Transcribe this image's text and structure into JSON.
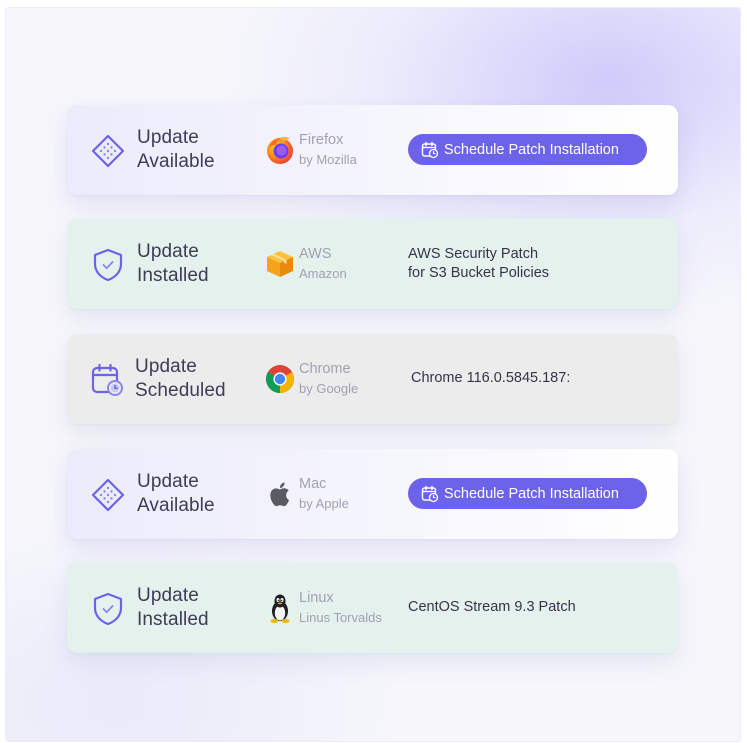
{
  "cards": [
    {
      "status_line1": "Update",
      "status_line2": "Available",
      "status_icon": "diamond-icon",
      "brand": "Firefox",
      "brand_sub": "by Mozilla",
      "brand_icon": "firefox-logo",
      "action_label": "Schedule Patch Installation"
    },
    {
      "status_line1": "Update",
      "status_line2": "Installed",
      "status_icon": "shield-check-icon",
      "brand": "AWS",
      "brand_sub": "Amazon",
      "brand_icon": "aws-box-logo",
      "info_line1": "AWS Security Patch",
      "info_line2": "for S3 Bucket Policies"
    },
    {
      "status_line1": "Update",
      "status_line2": "Scheduled",
      "status_icon": "calendar-clock-icon",
      "brand": "Chrome",
      "brand_sub": "by Google",
      "brand_icon": "chrome-logo",
      "info_line1": "Chrome 116.0.5845.187:"
    },
    {
      "status_line1": "Update",
      "status_line2": "Available",
      "status_icon": "diamond-icon",
      "brand": "Mac",
      "brand_sub": "by Apple",
      "brand_icon": "apple-logo",
      "action_label": "Schedule Patch Installation"
    },
    {
      "status_line1": "Update",
      "status_line2": "Installed",
      "status_icon": "shield-check-icon",
      "brand": "Linux",
      "brand_sub": "Linus Torvalds",
      "brand_icon": "tux-penguin-logo",
      "info_line1": "CentOS Stream 9.3 Patch"
    }
  ],
  "colors": {
    "accent": "#6c63ea",
    "available_bg": "#eeedfb",
    "installed_bg": "#e4f1ed",
    "scheduled_bg": "#ececec",
    "status_text": "#3e3c57",
    "brand_text": "#a2a1b3"
  }
}
